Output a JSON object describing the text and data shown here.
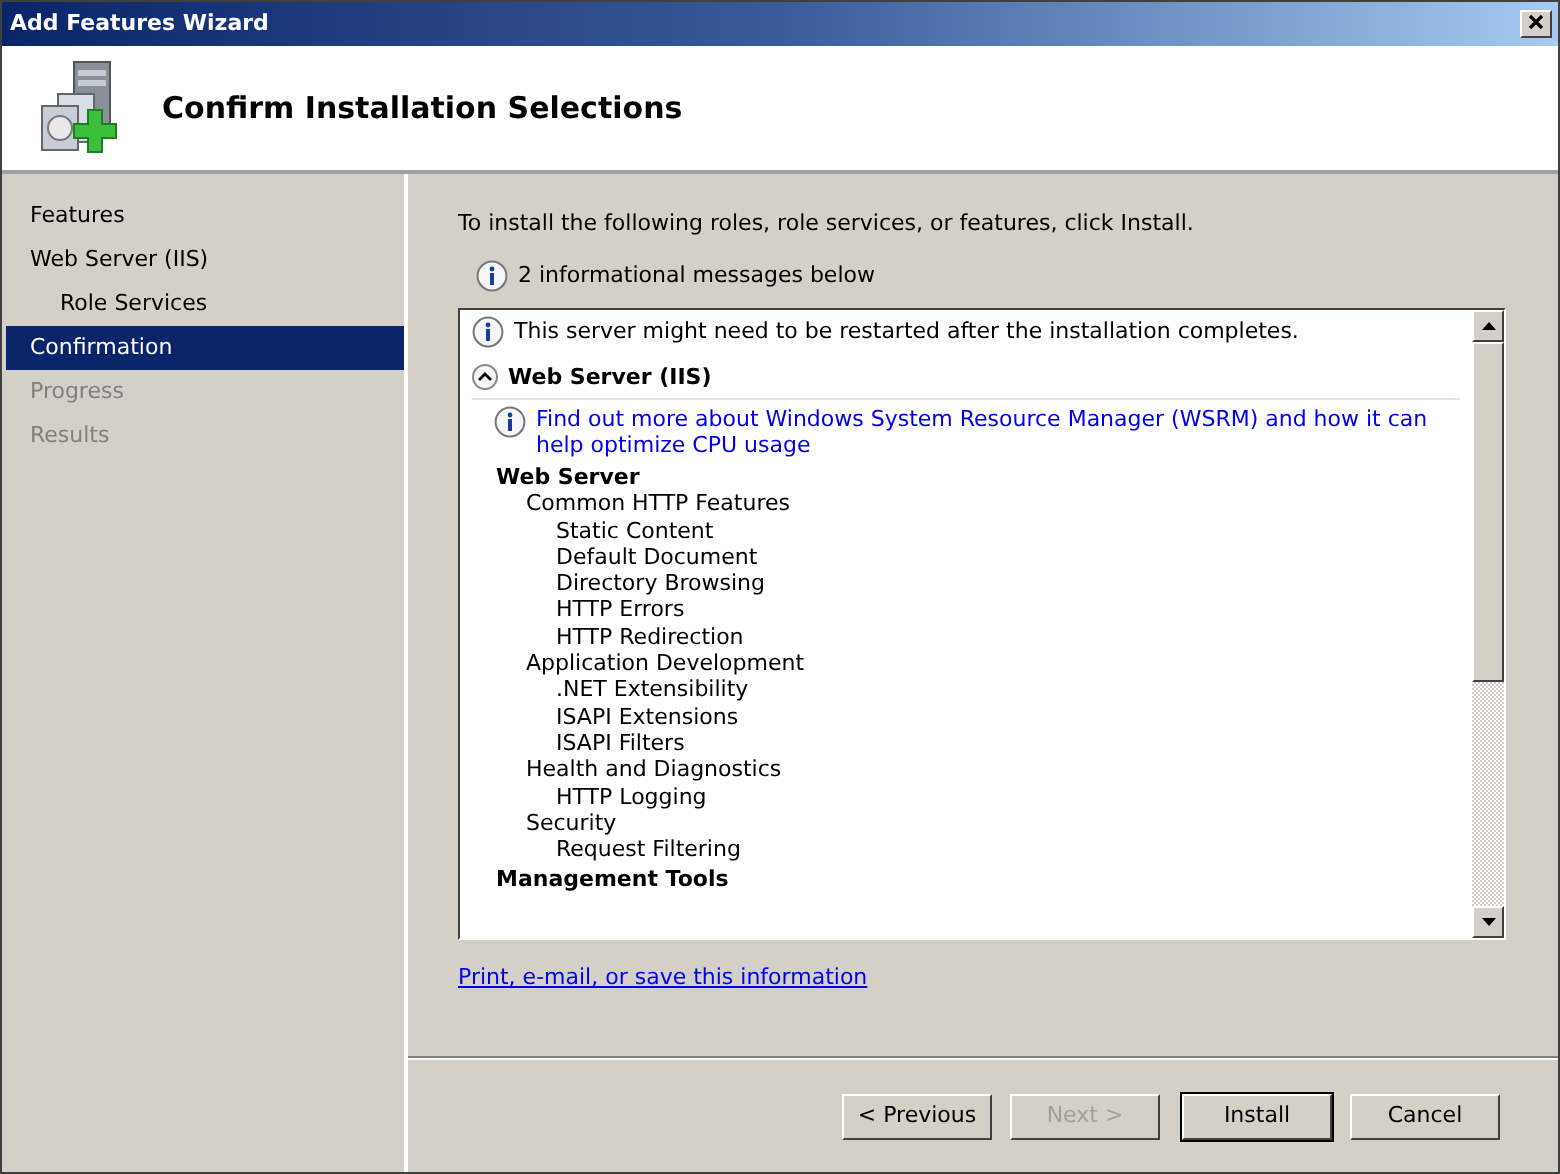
{
  "window": {
    "title": "Add Features Wizard"
  },
  "header": {
    "title": "Confirm Installation Selections"
  },
  "steps": [
    {
      "label": "Features",
      "selected": false,
      "disabled": false
    },
    {
      "label": "Web Server (IIS)",
      "selected": false,
      "disabled": false,
      "children": [
        {
          "label": "Role Services",
          "selected": false,
          "disabled": false
        }
      ]
    },
    {
      "label": "Confirmation",
      "selected": true,
      "disabled": false
    },
    {
      "label": "Progress",
      "selected": false,
      "disabled": true
    },
    {
      "label": "Results",
      "selected": false,
      "disabled": true
    }
  ],
  "intro": "To install the following roles, role services, or features, click Install.",
  "info_summary": "2 informational messages below",
  "details": {
    "notice": "This server might need to be restarted after the installation completes.",
    "section": {
      "title": "Web Server (IIS)",
      "expanded": true,
      "link": "Find out more about Windows System Resource Manager (WSRM) and how it can help optimize CPU usage",
      "tree": [
        {
          "label": "Web Server",
          "children": [
            {
              "label": "Common HTTP Features",
              "children": [
                {
                  "label": "Static Content"
                },
                {
                  "label": "Default Document"
                },
                {
                  "label": "Directory Browsing"
                },
                {
                  "label": "HTTP Errors"
                },
                {
                  "label": "HTTP Redirection"
                }
              ]
            },
            {
              "label": "Application Development",
              "children": [
                {
                  "label": ".NET Extensibility"
                },
                {
                  "label": "ISAPI Extensions"
                },
                {
                  "label": "ISAPI Filters"
                }
              ]
            },
            {
              "label": "Health and Diagnostics",
              "children": [
                {
                  "label": "HTTP Logging"
                }
              ]
            },
            {
              "label": "Security",
              "children": [
                {
                  "label": "Request Filtering"
                }
              ]
            }
          ]
        },
        {
          "label": "Management Tools"
        }
      ]
    }
  },
  "print_link": "Print, e-mail, or save this information",
  "buttons": [
    {
      "label": "< Previous",
      "disabled": false,
      "default": false
    },
    {
      "label": "Next >",
      "disabled": true,
      "default": false
    },
    {
      "label": "Install",
      "disabled": false,
      "default": true
    },
    {
      "label": "Cancel",
      "disabled": false,
      "default": false
    }
  ]
}
